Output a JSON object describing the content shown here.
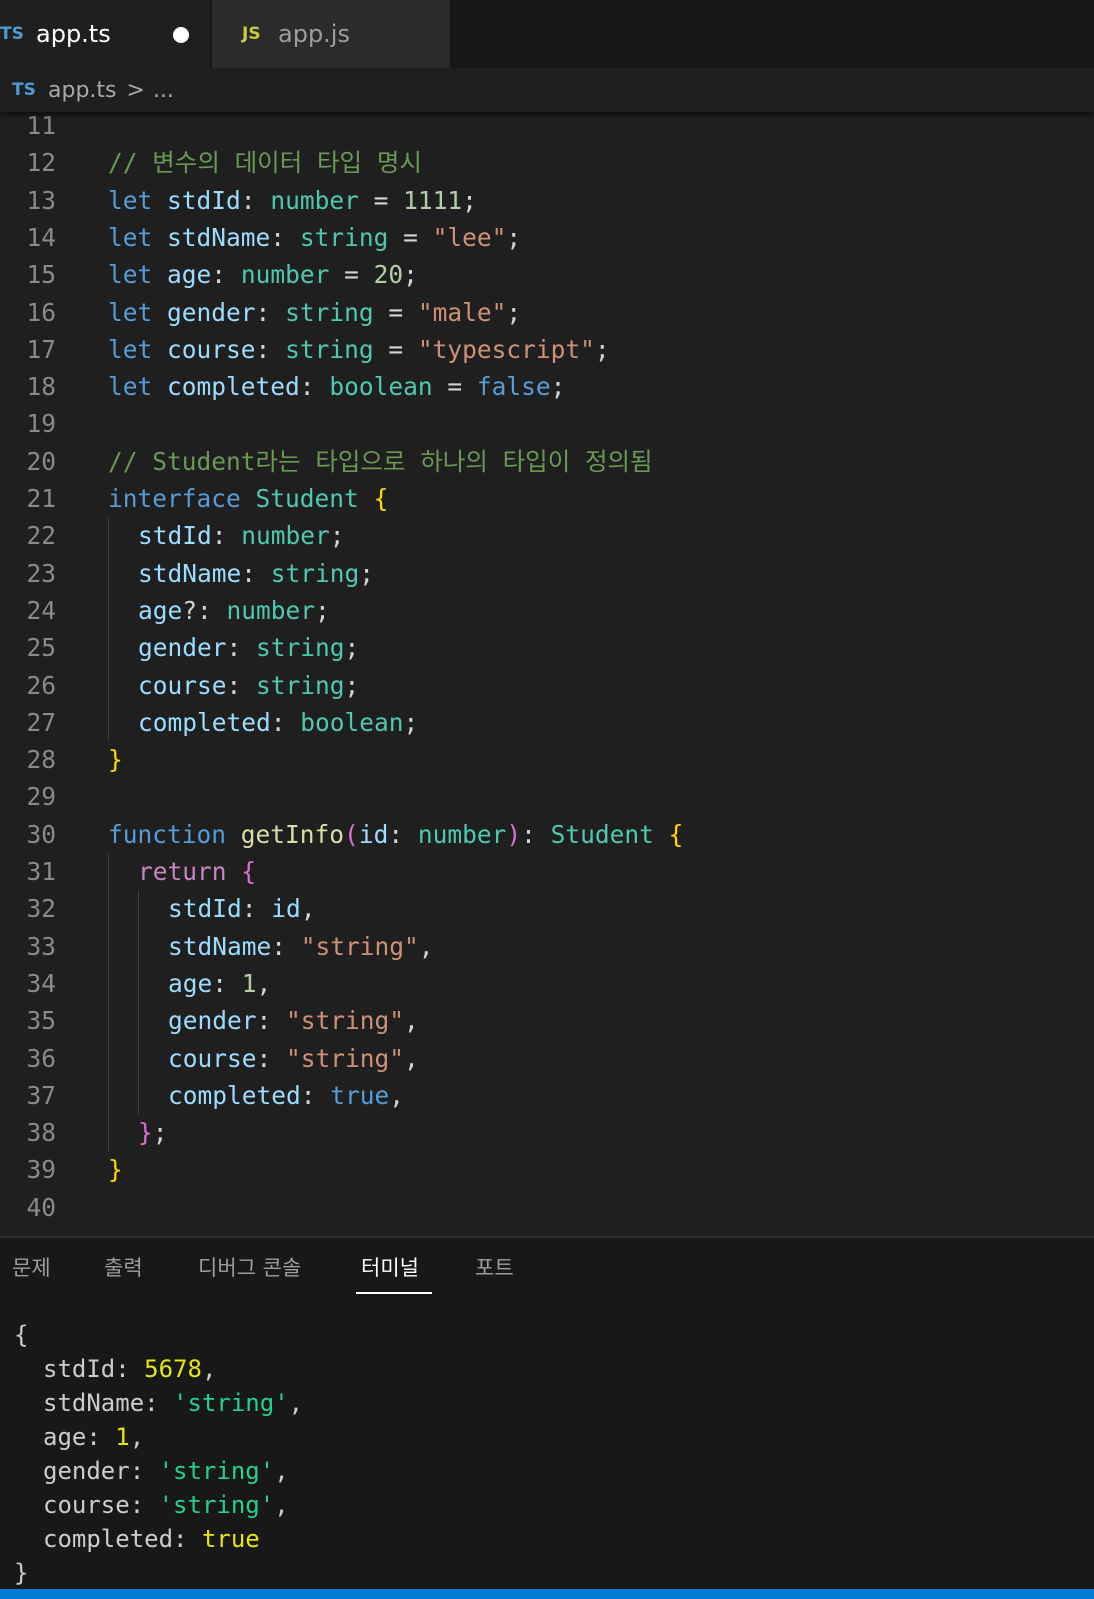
{
  "tabs": [
    {
      "badge": "TS",
      "label": "app.ts",
      "modified": true
    },
    {
      "badge": "JS",
      "label": "app.js",
      "modified": false
    }
  ],
  "breadcrumb": {
    "badge": "TS",
    "file": "app.ts",
    "separator": ">",
    "more": "..."
  },
  "editor": {
    "lines": [
      {
        "n": "11",
        "indent": 0,
        "tokens": []
      },
      {
        "n": "12",
        "indent": 0,
        "tokens": [
          [
            "cm",
            "// 변수의 데이터 타입 명시"
          ]
        ]
      },
      {
        "n": "13",
        "indent": 0,
        "tokens": [
          [
            "kw",
            "let"
          ],
          [
            "pn",
            " "
          ],
          [
            "id",
            "stdId"
          ],
          [
            "pn",
            ": "
          ],
          [
            "ty",
            "number"
          ],
          [
            "pn",
            " = "
          ],
          [
            "num",
            "1111"
          ],
          [
            "pn",
            ";"
          ]
        ]
      },
      {
        "n": "14",
        "indent": 0,
        "tokens": [
          [
            "kw",
            "let"
          ],
          [
            "pn",
            " "
          ],
          [
            "id",
            "stdName"
          ],
          [
            "pn",
            ": "
          ],
          [
            "ty",
            "string"
          ],
          [
            "pn",
            " = "
          ],
          [
            "str",
            "\"lee\""
          ],
          [
            "pn",
            ";"
          ]
        ]
      },
      {
        "n": "15",
        "indent": 0,
        "tokens": [
          [
            "kw",
            "let"
          ],
          [
            "pn",
            " "
          ],
          [
            "id",
            "age"
          ],
          [
            "pn",
            ": "
          ],
          [
            "ty",
            "number"
          ],
          [
            "pn",
            " = "
          ],
          [
            "num",
            "20"
          ],
          [
            "pn",
            ";"
          ]
        ]
      },
      {
        "n": "16",
        "indent": 0,
        "tokens": [
          [
            "kw",
            "let"
          ],
          [
            "pn",
            " "
          ],
          [
            "id",
            "gender"
          ],
          [
            "pn",
            ": "
          ],
          [
            "ty",
            "string"
          ],
          [
            "pn",
            " = "
          ],
          [
            "str",
            "\"male\""
          ],
          [
            "pn",
            ";"
          ]
        ]
      },
      {
        "n": "17",
        "indent": 0,
        "tokens": [
          [
            "kw",
            "let"
          ],
          [
            "pn",
            " "
          ],
          [
            "id",
            "course"
          ],
          [
            "pn",
            ": "
          ],
          [
            "ty",
            "string"
          ],
          [
            "pn",
            " = "
          ],
          [
            "str",
            "\"typescript\""
          ],
          [
            "pn",
            ";"
          ]
        ]
      },
      {
        "n": "18",
        "indent": 0,
        "tokens": [
          [
            "kw",
            "let"
          ],
          [
            "pn",
            " "
          ],
          [
            "id",
            "completed"
          ],
          [
            "pn",
            ": "
          ],
          [
            "ty",
            "boolean"
          ],
          [
            "pn",
            " = "
          ],
          [
            "kw",
            "false"
          ],
          [
            "pn",
            ";"
          ]
        ]
      },
      {
        "n": "19",
        "indent": 0,
        "tokens": []
      },
      {
        "n": "20",
        "indent": 0,
        "tokens": [
          [
            "cm",
            "// Student라는 타입으로 하나의 타입이 정의됨"
          ]
        ]
      },
      {
        "n": "21",
        "indent": 0,
        "tokens": [
          [
            "kw",
            "interface"
          ],
          [
            "pn",
            " "
          ],
          [
            "ty",
            "Student"
          ],
          [
            "pn",
            " "
          ],
          [
            "b1",
            "{"
          ]
        ]
      },
      {
        "n": "22",
        "indent": 1,
        "tokens": [
          [
            "id",
            "stdId"
          ],
          [
            "pn",
            ": "
          ],
          [
            "ty",
            "number"
          ],
          [
            "pn",
            ";"
          ]
        ]
      },
      {
        "n": "23",
        "indent": 1,
        "tokens": [
          [
            "id",
            "stdName"
          ],
          [
            "pn",
            ": "
          ],
          [
            "ty",
            "string"
          ],
          [
            "pn",
            ";"
          ]
        ]
      },
      {
        "n": "24",
        "indent": 1,
        "tokens": [
          [
            "id",
            "age"
          ],
          [
            "pn",
            "?: "
          ],
          [
            "ty",
            "number"
          ],
          [
            "pn",
            ";"
          ]
        ]
      },
      {
        "n": "25",
        "indent": 1,
        "tokens": [
          [
            "id",
            "gender"
          ],
          [
            "pn",
            ": "
          ],
          [
            "ty",
            "string"
          ],
          [
            "pn",
            ";"
          ]
        ]
      },
      {
        "n": "26",
        "indent": 1,
        "tokens": [
          [
            "id",
            "course"
          ],
          [
            "pn",
            ": "
          ],
          [
            "ty",
            "string"
          ],
          [
            "pn",
            ";"
          ]
        ]
      },
      {
        "n": "27",
        "indent": 1,
        "tokens": [
          [
            "id",
            "completed"
          ],
          [
            "pn",
            ": "
          ],
          [
            "ty",
            "boolean"
          ],
          [
            "pn",
            ";"
          ]
        ]
      },
      {
        "n": "28",
        "indent": 0,
        "tokens": [
          [
            "b1",
            "}"
          ]
        ]
      },
      {
        "n": "29",
        "indent": 0,
        "tokens": []
      },
      {
        "n": "30",
        "indent": 0,
        "tokens": [
          [
            "kw",
            "function"
          ],
          [
            "pn",
            " "
          ],
          [
            "fn",
            "getInfo"
          ],
          [
            "b2",
            "("
          ],
          [
            "id",
            "id"
          ],
          [
            "pn",
            ": "
          ],
          [
            "ty",
            "number"
          ],
          [
            "b2",
            ")"
          ],
          [
            "pn",
            ": "
          ],
          [
            "ty",
            "Student"
          ],
          [
            "pn",
            " "
          ],
          [
            "b1",
            "{"
          ]
        ]
      },
      {
        "n": "31",
        "indent": 1,
        "tokens": [
          [
            "ctl",
            "return"
          ],
          [
            "pn",
            " "
          ],
          [
            "b2",
            "{"
          ]
        ]
      },
      {
        "n": "32",
        "indent": 2,
        "tokens": [
          [
            "id",
            "stdId"
          ],
          [
            "pn",
            ": "
          ],
          [
            "id",
            "id"
          ],
          [
            "pn",
            ","
          ]
        ]
      },
      {
        "n": "33",
        "indent": 2,
        "tokens": [
          [
            "id",
            "stdName"
          ],
          [
            "pn",
            ": "
          ],
          [
            "str",
            "\"string\""
          ],
          [
            "pn",
            ","
          ]
        ]
      },
      {
        "n": "34",
        "indent": 2,
        "tokens": [
          [
            "id",
            "age"
          ],
          [
            "pn",
            ": "
          ],
          [
            "num",
            "1"
          ],
          [
            "pn",
            ","
          ]
        ]
      },
      {
        "n": "35",
        "indent": 2,
        "tokens": [
          [
            "id",
            "gender"
          ],
          [
            "pn",
            ": "
          ],
          [
            "str",
            "\"string\""
          ],
          [
            "pn",
            ","
          ]
        ]
      },
      {
        "n": "36",
        "indent": 2,
        "tokens": [
          [
            "id",
            "course"
          ],
          [
            "pn",
            ": "
          ],
          [
            "str",
            "\"string\""
          ],
          [
            "pn",
            ","
          ]
        ]
      },
      {
        "n": "37",
        "indent": 2,
        "tokens": [
          [
            "id",
            "completed"
          ],
          [
            "pn",
            ": "
          ],
          [
            "kw",
            "true"
          ],
          [
            "pn",
            ","
          ]
        ]
      },
      {
        "n": "38",
        "indent": 1,
        "tokens": [
          [
            "b2",
            "}"
          ],
          [
            "pn",
            ";"
          ]
        ]
      },
      {
        "n": "39",
        "indent": 0,
        "tokens": [
          [
            "b1",
            "}"
          ]
        ]
      },
      {
        "n": "40",
        "indent": 0,
        "tokens": []
      }
    ]
  },
  "panel": {
    "tabs": [
      {
        "label": "문제",
        "active": false
      },
      {
        "label": "출력",
        "active": false
      },
      {
        "label": "디버그 콘솔",
        "active": false
      },
      {
        "label": "터미널",
        "active": true
      },
      {
        "label": "포트",
        "active": false
      }
    ],
    "terminal_lines": [
      {
        "indent": 0,
        "tokens": [
          [
            "p",
            "{"
          ]
        ]
      },
      {
        "indent": 1,
        "tokens": [
          [
            "p",
            "stdId: "
          ],
          [
            "tnum",
            "5678"
          ],
          [
            "p",
            ","
          ]
        ]
      },
      {
        "indent": 1,
        "tokens": [
          [
            "p",
            "stdName: "
          ],
          [
            "tstr",
            "'string'"
          ],
          [
            "p",
            ","
          ]
        ]
      },
      {
        "indent": 1,
        "tokens": [
          [
            "p",
            "age: "
          ],
          [
            "tnum",
            "1"
          ],
          [
            "p",
            ","
          ]
        ]
      },
      {
        "indent": 1,
        "tokens": [
          [
            "p",
            "gender: "
          ],
          [
            "tstr",
            "'string'"
          ],
          [
            "p",
            ","
          ]
        ]
      },
      {
        "indent": 1,
        "tokens": [
          [
            "p",
            "course: "
          ],
          [
            "tstr",
            "'string'"
          ],
          [
            "p",
            ","
          ]
        ]
      },
      {
        "indent": 1,
        "tokens": [
          [
            "p",
            "completed: "
          ],
          [
            "tbool",
            "true"
          ]
        ]
      },
      {
        "indent": 0,
        "tokens": [
          [
            "p",
            "}"
          ]
        ]
      }
    ]
  }
}
